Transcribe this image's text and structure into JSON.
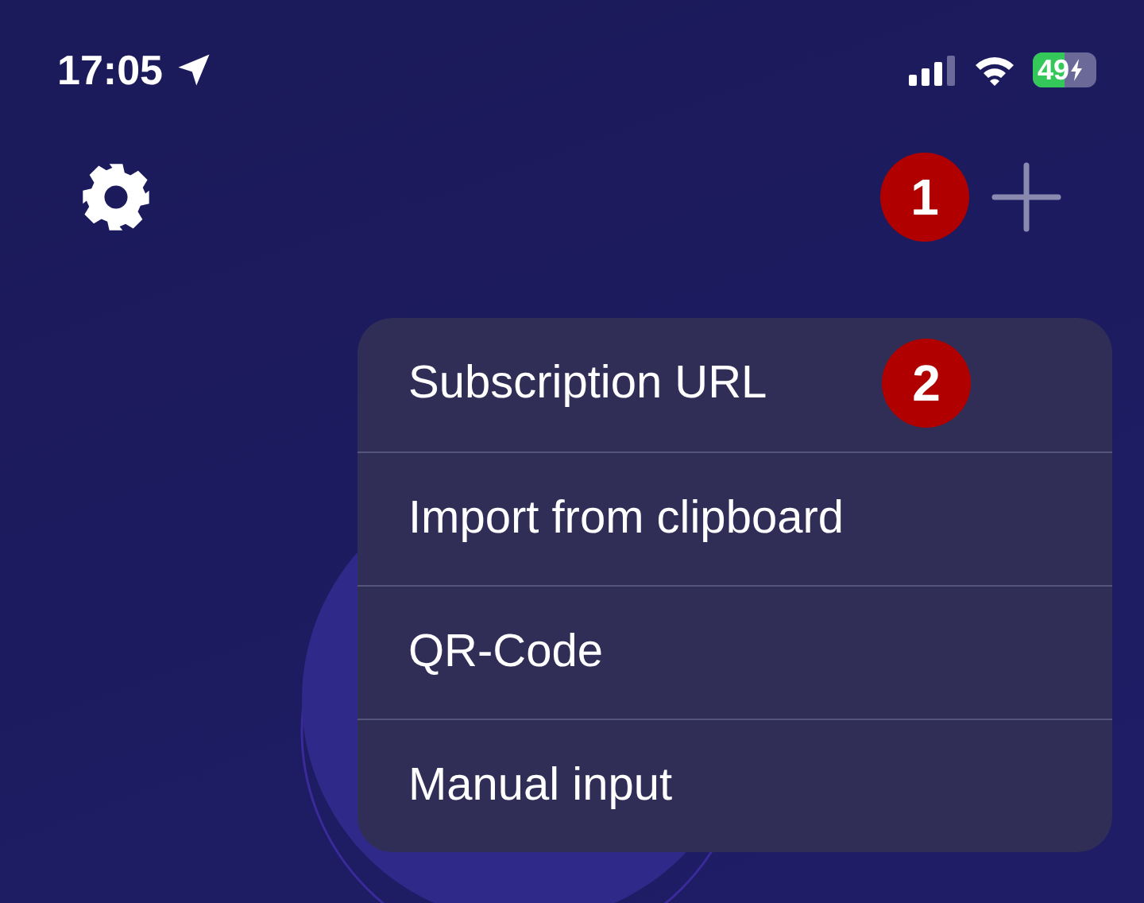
{
  "status_bar": {
    "time": "17:05",
    "battery": "49"
  },
  "badges": [
    {
      "label": "1"
    },
    {
      "label": "2"
    }
  ],
  "menu": {
    "items": [
      {
        "label": "Subscription URL"
      },
      {
        "label": "Import from clipboard"
      },
      {
        "label": "QR-Code"
      },
      {
        "label": "Manual input"
      }
    ]
  }
}
